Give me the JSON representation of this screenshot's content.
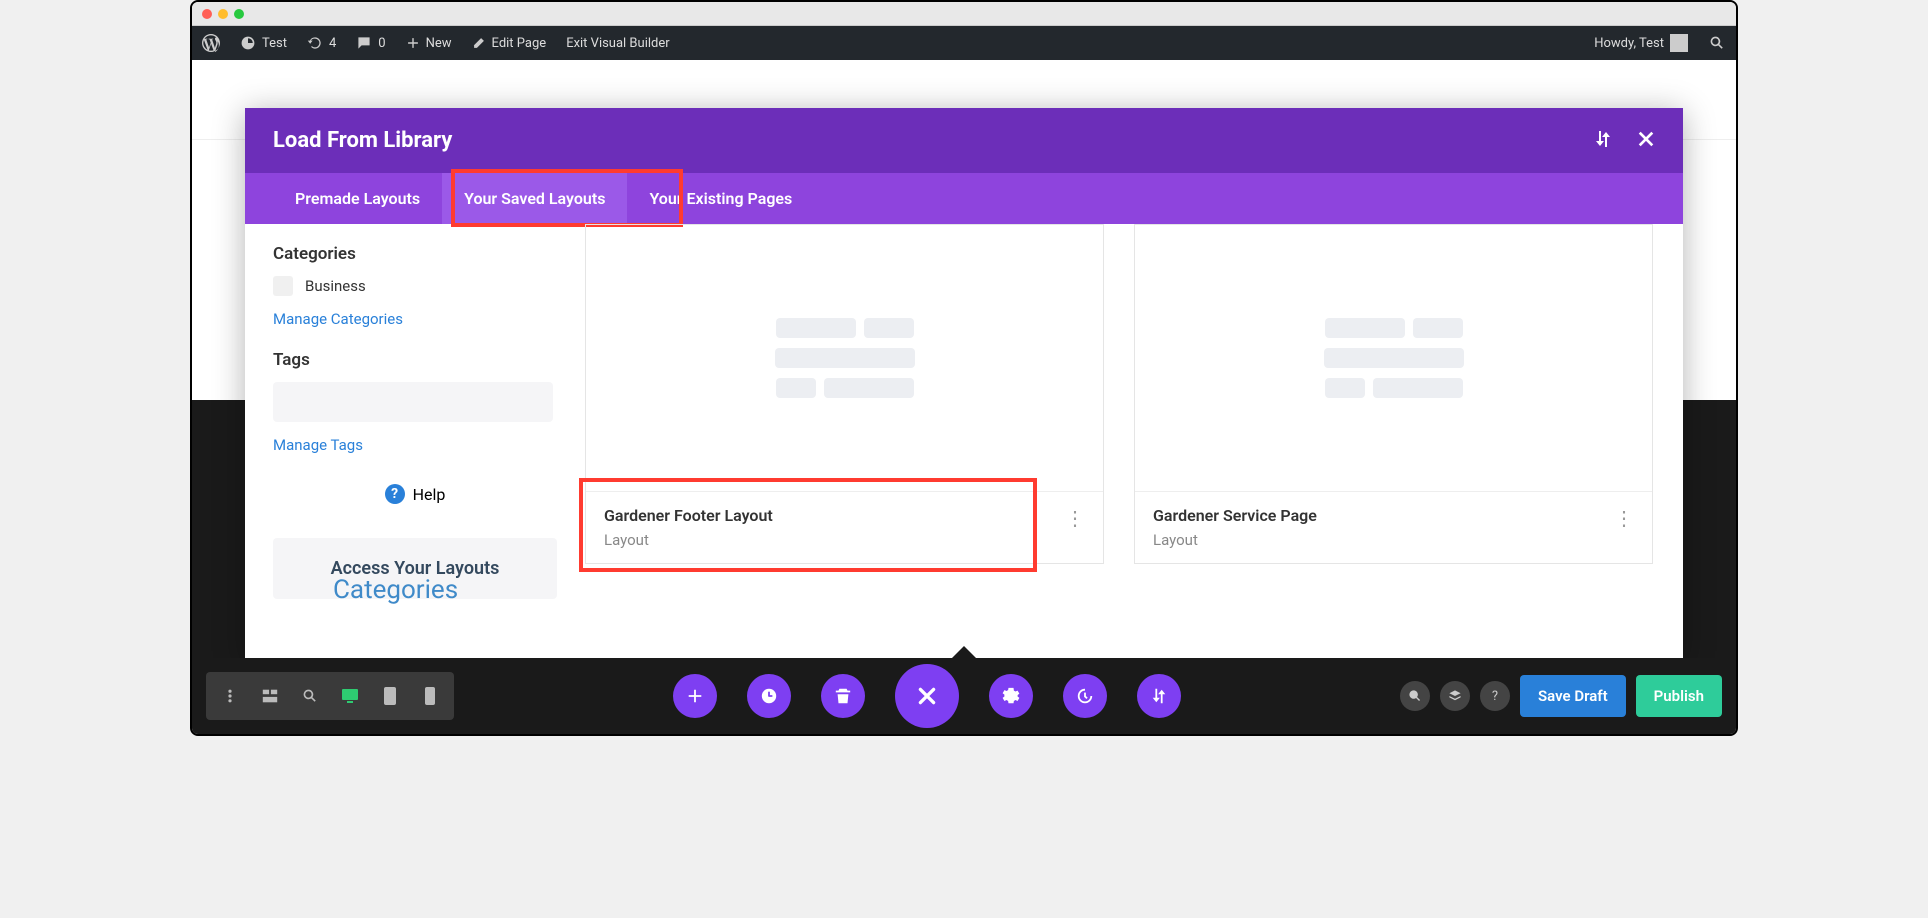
{
  "adminbar": {
    "site": "Test",
    "updates": "4",
    "comments": "0",
    "new": "New",
    "edit": "Edit Page",
    "exit": "Exit Visual Builder",
    "howdy": "Howdy, Test"
  },
  "modal": {
    "title": "Load From Library",
    "tabs": {
      "premade": "Premade Layouts",
      "saved": "Your Saved Layouts",
      "existing": "Your Existing Pages"
    }
  },
  "sidebar": {
    "categories_heading": "Categories",
    "business": "Business",
    "manage_categories": "Manage Categories",
    "tags_heading": "Tags",
    "manage_tags": "Manage Tags",
    "help": "Help",
    "access": "Access Your Layouts",
    "categories_overlay": "Categories"
  },
  "cards": {
    "c1": {
      "title": "Gardener Footer Layout",
      "sub": "Layout"
    },
    "c2": {
      "title": "Gardener Service Page",
      "sub": "Layout"
    }
  },
  "bottombar": {
    "save_draft": "Save Draft",
    "publish": "Publish"
  }
}
